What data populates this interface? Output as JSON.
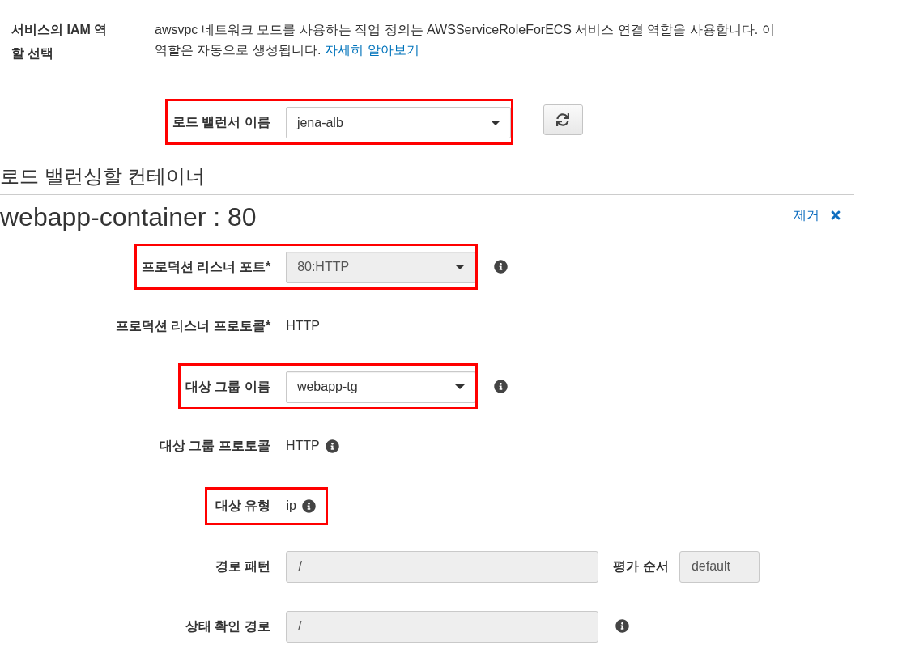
{
  "iam_role": {
    "label": "서비스의 IAM 역할 선택",
    "description": "awsvpc 네트워크 모드를 사용하는 작업 정의는 AWSServiceRoleForECS 서비스 연결 역할을 사용합니다. 이 역할은 자동으로 생성됩니다.",
    "link": "자세히 알아보기"
  },
  "load_balancer": {
    "label": "로드 밸런서 이름",
    "value": "jena-alb",
    "disabled": false,
    "highlighted": true
  },
  "section": {
    "title": "로드 밸런싱할 컨테이너"
  },
  "container": {
    "title": "webapp-container : 80",
    "remove_link": "제거"
  },
  "fields": [
    {
      "kind": "select",
      "label": "프로덕션 리스너 포트*",
      "value": "80:HTTP",
      "disabled": true,
      "info": true,
      "highlighted": true
    },
    {
      "kind": "text",
      "label": "프로덕션 리스너 프로토콜*",
      "value": "HTTP",
      "info": false,
      "highlighted": false
    },
    {
      "kind": "select",
      "label": "대상 그룹 이름",
      "value": "webapp-tg",
      "disabled": false,
      "info": true,
      "highlighted": true
    },
    {
      "kind": "text",
      "label": "대상 그룹 프로토콜",
      "value": "HTTP",
      "info": true,
      "highlighted": false
    },
    {
      "kind": "text",
      "label": "대상 유형",
      "value": "ip",
      "info": true,
      "highlighted": true
    },
    {
      "kind": "input",
      "label": "경로 패턴",
      "value": "/",
      "disabled": true,
      "info": false,
      "highlighted": false,
      "secondary": {
        "label": "평가 순서",
        "value": "default",
        "disabled": true
      }
    },
    {
      "kind": "input",
      "label": "상태 확인 경로",
      "value": "/",
      "disabled": true,
      "info": true,
      "highlighted": false
    }
  ]
}
